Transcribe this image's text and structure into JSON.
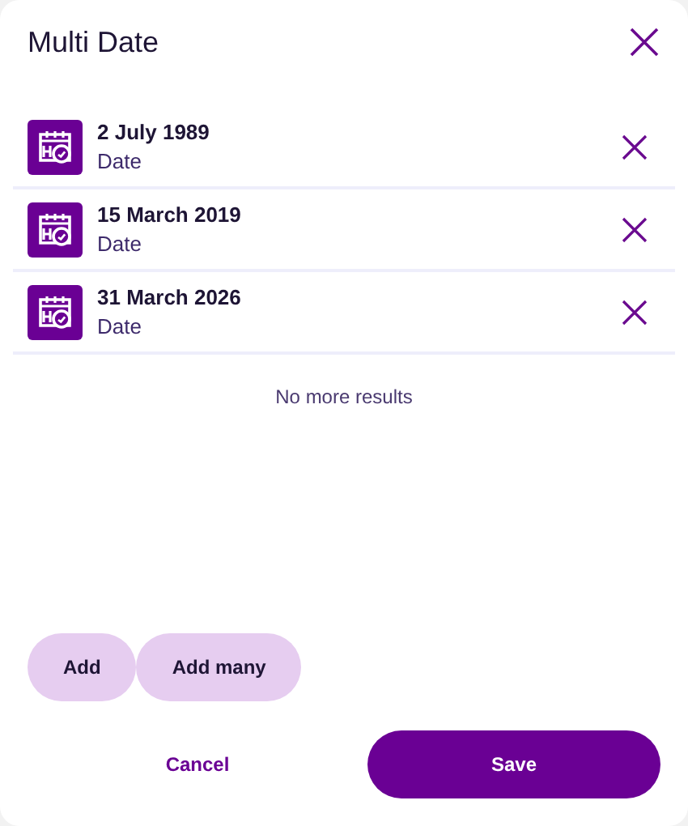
{
  "dialog": {
    "title": "Multi Date"
  },
  "items": [
    {
      "value": "2 July 1989",
      "type": "Date"
    },
    {
      "value": "15 March 2019",
      "type": "Date"
    },
    {
      "value": "31 March 2026",
      "type": "Date"
    }
  ],
  "end_message": "No more results",
  "add_buttons": [
    "Add",
    "Add many"
  ],
  "footer": {
    "cancel": "Cancel",
    "save": "Save"
  }
}
